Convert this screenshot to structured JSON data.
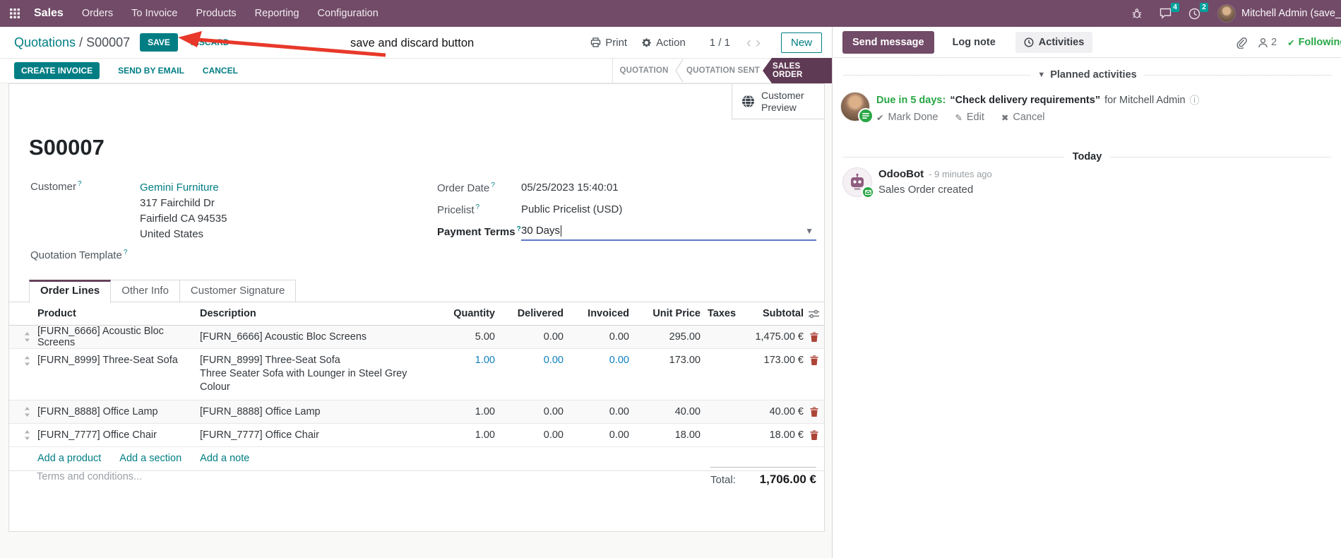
{
  "colors": {
    "brand_purple": "#714B67",
    "primary_teal": "#017e84",
    "active_state_bg": "#5f3a54",
    "badge_teal": "#00A09D",
    "success_green": "#28a745",
    "modified_field_blue": "#0d7fbe",
    "annotation_red": "#e8382a"
  },
  "ui": {
    "help": "?"
  },
  "topbar": {
    "app_name": "Sales",
    "menus": [
      "Orders",
      "To Invoice",
      "Products",
      "Reporting",
      "Configuration"
    ],
    "badges": {
      "messages": "4",
      "activities": "2"
    },
    "user": "Mitchell Admin (save_discard"
  },
  "control": {
    "breadcrumb_parent": "Quotations",
    "breadcrumb_current": "/ S00007",
    "save": "SAVE",
    "discard": "DISCARD",
    "print": "Print",
    "action": "Action",
    "pager": "1 / 1",
    "prev": "‹",
    "next": "›",
    "new": "New"
  },
  "annotation": {
    "label": "save and discard button"
  },
  "statusbar": {
    "create_invoice": "CREATE INVOICE",
    "send_by_email": "SEND BY EMAIL",
    "cancel": "CANCEL",
    "states": [
      "QUOTATION",
      "QUOTATION SENT",
      "SALES ORDER"
    ],
    "active_state": "SALES ORDER"
  },
  "sheet": {
    "customer_preview": "Customer Preview",
    "title": "S00007",
    "fields": {
      "customer_label": "Customer",
      "customer_name": "Gemini Furniture",
      "address_line1": "317 Fairchild Dr",
      "address_line2": "Fairfield CA 94535",
      "address_line3": "United States",
      "quotation_template_label": "Quotation Template",
      "order_date_label": "Order Date",
      "order_date": "05/25/2023 15:40:01",
      "pricelist_label": "Pricelist",
      "pricelist": "Public Pricelist (USD)",
      "payment_terms_label": "Payment Terms",
      "payment_terms": "30 Days"
    },
    "tabs": [
      "Order Lines",
      "Other Info",
      "Customer Signature"
    ],
    "table": {
      "headers": [
        "Product",
        "Description",
        "Quantity",
        "Delivered",
        "Invoiced",
        "Unit Price",
        "Taxes",
        "Subtotal"
      ],
      "rows": [
        {
          "product": "[FURN_6666] Acoustic Bloc Screens",
          "description": "[FURN_6666] Acoustic Bloc Screens",
          "quantity": "5.00",
          "delivered": "0.00",
          "invoiced": "0.00",
          "unit_price": "295.00",
          "taxes": "",
          "subtotal": "1,475.00 €"
        },
        {
          "product": "[FURN_8999] Three-Seat Sofa",
          "description": "[FURN_8999] Three-Seat Sofa",
          "description2": "Three Seater Sofa with Lounger in Steel Grey Colour",
          "quantity": "1.00",
          "delivered": "0.00",
          "invoiced": "0.00",
          "unit_price": "173.00",
          "taxes": "",
          "subtotal": "173.00 €"
        },
        {
          "product": "[FURN_8888] Office Lamp",
          "description": "[FURN_8888] Office Lamp",
          "quantity": "1.00",
          "delivered": "0.00",
          "invoiced": "0.00",
          "unit_price": "40.00",
          "taxes": "",
          "subtotal": "40.00 €"
        },
        {
          "product": "[FURN_7777] Office Chair",
          "description": "[FURN_7777] Office Chair",
          "quantity": "1.00",
          "delivered": "0.00",
          "invoiced": "0.00",
          "unit_price": "18.00",
          "taxes": "",
          "subtotal": "18.00 €"
        }
      ],
      "links": [
        "Add a product",
        "Add a section",
        "Add a note"
      ],
      "terms_placeholder": "Terms and conditions...",
      "total_label": "Total:",
      "total_value": "1,706.00 €"
    }
  },
  "chatter": {
    "send_message": "Send message",
    "log_note": "Log note",
    "activities": "Activities",
    "followers_count": "2",
    "following": "Following",
    "planned_header": "Planned activities",
    "activity": {
      "due": "Due in 5 days:",
      "title": "“Check delivery requirements”",
      "for_text": "for Mitchell Admin",
      "mark_done": "Mark Done",
      "edit": "Edit",
      "cancel": "Cancel"
    },
    "today": "Today",
    "message": {
      "author": "OdooBot",
      "time": "- 9 minutes ago",
      "body": "Sales Order created"
    }
  }
}
